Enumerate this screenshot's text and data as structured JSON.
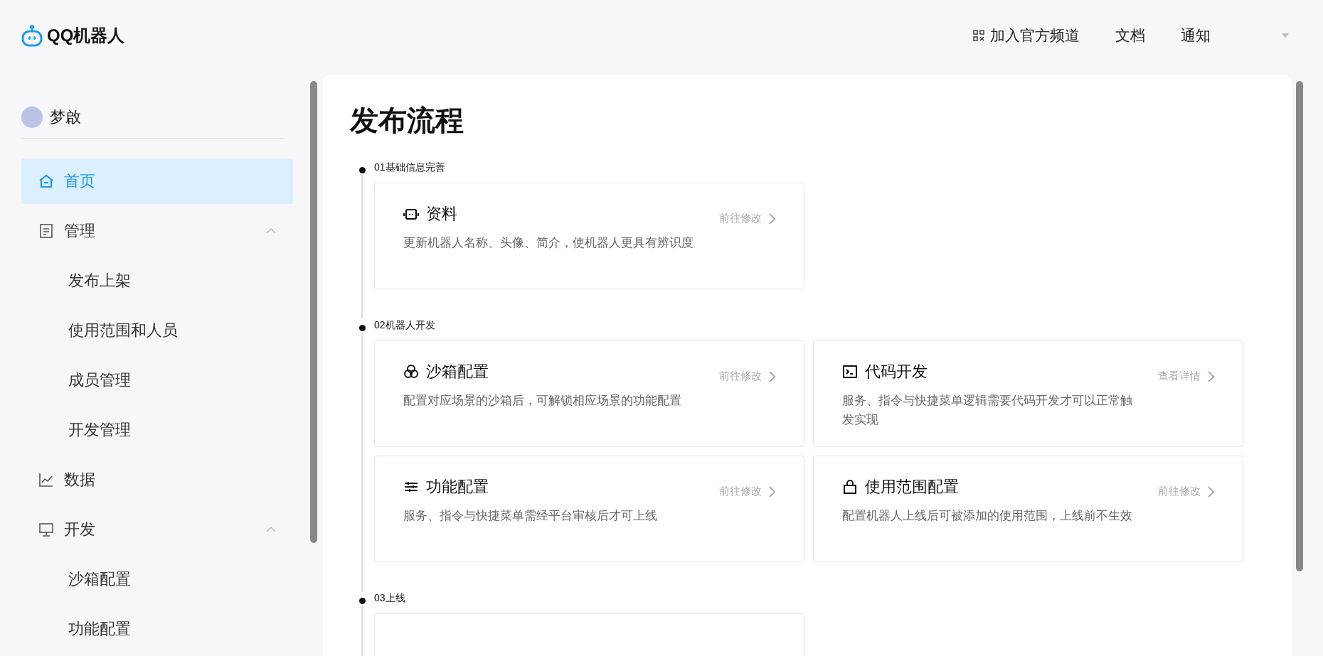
{
  "header": {
    "logo": "QQ机器人",
    "nav": [
      "加入官方频道",
      "文档",
      "通知"
    ]
  },
  "sidebar": {
    "user": {
      "name": "梦啟"
    },
    "items": [
      {
        "label": "首页",
        "selected": true
      },
      {
        "label": "管理",
        "selected": false,
        "expanded": true,
        "children": [
          {
            "label": "发布上架",
            "selected": false
          },
          {
            "label": "使用范围和人员",
            "selected": false
          },
          {
            "label": "成员管理",
            "selected": false
          },
          {
            "label": "开发管理",
            "selected": false
          }
        ]
      },
      {
        "label": "数据",
        "selected": false
      },
      {
        "label": "开发",
        "selected": false,
        "expanded": true,
        "children": [
          {
            "label": "沙箱配置",
            "selected": false
          },
          {
            "label": "功能配置",
            "selected": false
          }
        ]
      }
    ]
  },
  "page": {
    "title": "发布流程",
    "steps": [
      {
        "label": "01基础信息完善",
        "cards": [
          {
            "kind": "full",
            "title": "资料",
            "description": "更新机器人名称、头像、简介，使机器人更具有辨识度",
            "action": "前往修改"
          }
        ]
      },
      {
        "label": "02机器人开发",
        "cards": [
          {
            "kind": "full",
            "title": "沙箱配置",
            "description": "配置对应场景的沙箱后，可解锁相应场景的功能配置",
            "action": "前往修改"
          },
          {
            "kind": "full",
            "title": "代码开发",
            "description": "服务、指令与快捷菜单逻辑需要代码开发才可以正常触发实现",
            "action": "查看详情"
          },
          {
            "kind": "full",
            "title": "功能配置",
            "description": "服务、指令与快捷菜单需经平台审核后才可上线",
            "action": "前往修改"
          },
          {
            "kind": "full",
            "title": "使用范围配置",
            "description": "配置机器人上线后可被添加的使用范围，上线前不生效",
            "action": "前往修改"
          }
        ]
      },
      {
        "label": "03上线",
        "cards": [
          {
            "kind": "cut"
          }
        ]
      }
    ]
  }
}
